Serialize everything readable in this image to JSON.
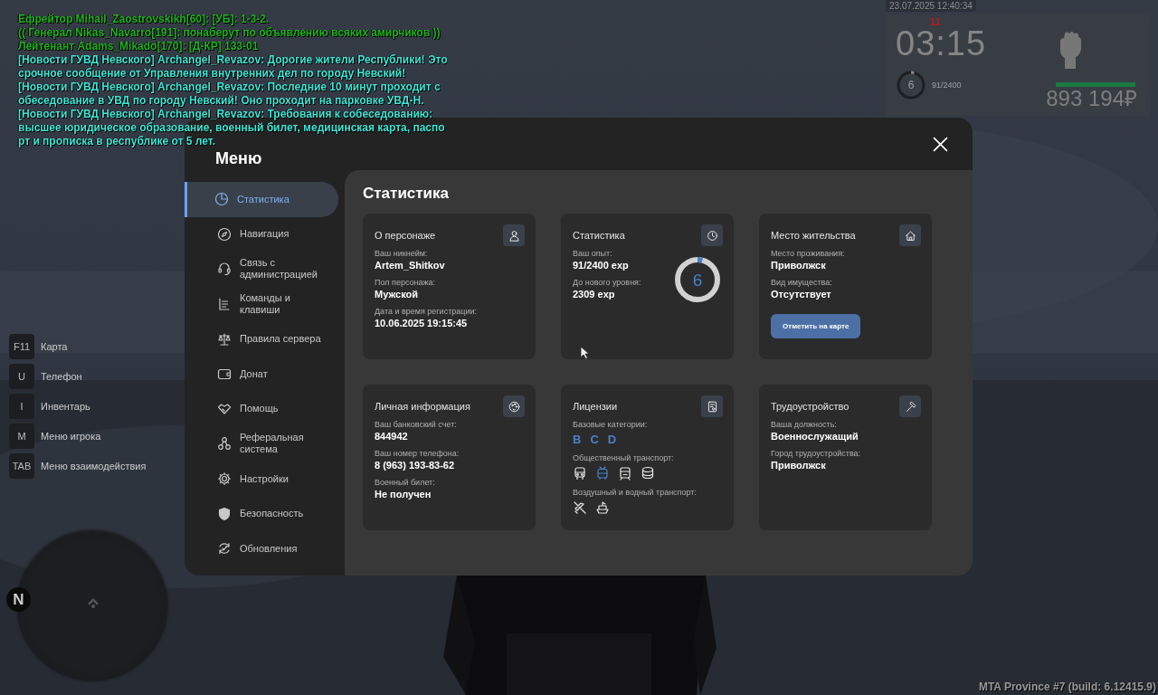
{
  "chat": [
    {
      "text": "Ефрейтор Mihail_Zaostrovskikh[60]: [УБ]: 1-3-2.",
      "color": "#1fb51f"
    },
    {
      "text": "(( Генерал Nikas_Navarro[191]: понаберут по объявлению всяких амирчиков ))",
      "color": "#1fb51f"
    },
    {
      "text": "Лейтенант Adams_Mikado[170]: [Д-КР] 133-01",
      "color": "#1fb51f"
    },
    {
      "text": "[Новости ГУВД Невского] Archangel_Revazov: Дорогие жители Республики! Это",
      "color": "#3ee8d8"
    },
    {
      "text": "срочное сообщение от Управления внутренних дел по городу Невский!",
      "color": "#3ee8d8"
    },
    {
      "text": "[Новости ГУВД Невского] Archangel_Revazov: Последние 10 минут проходит с",
      "color": "#3ee8d8"
    },
    {
      "text": "обеседование в УВД по городу Невский! Оно проходит на парковке УВД-Н.",
      "color": "#3ee8d8"
    },
    {
      "text": "[Новости ГУВД Невского] Archangel_Revazov: Требования к собеседованию:",
      "color": "#3ee8d8"
    },
    {
      "text": "высшее юридическое образование, военный билет, медицинская карта, паспо",
      "color": "#3ee8d8"
    },
    {
      "text": "рт и прописка в республике от 5 лет.",
      "color": "#3ee8d8"
    }
  ],
  "hud": {
    "date": "23.07.2025 12:40:34",
    "alert": "11",
    "time": "03:15",
    "ring": {
      "label": "6",
      "level": 0.04
    },
    "xp": "91/2400",
    "health": {
      "level": 1
    },
    "money": "893 194₽"
  },
  "keys": [
    {
      "key": "F11",
      "label": "Карта"
    },
    {
      "key": "U",
      "label": "Телефон"
    },
    {
      "key": "I",
      "label": "Инвентарь"
    },
    {
      "key": "M",
      "label": "Меню игрока"
    },
    {
      "key": "TAB",
      "label": "Меню взаимодействия"
    }
  ],
  "minimap": {
    "north": "N"
  },
  "menu": {
    "title": "Меню",
    "sidebar": [
      {
        "label": "Статистика",
        "selected": true
      },
      {
        "label": "Навигация",
        "selected": false
      },
      {
        "label": "Связь с администрацией",
        "selected": false
      },
      {
        "label": "Команды и клавиши",
        "selected": false
      },
      {
        "label": "Правила сервера",
        "selected": false
      },
      {
        "label": "Донат",
        "selected": false
      },
      {
        "label": "Помощь",
        "selected": false
      },
      {
        "label": "Реферальная система",
        "selected": false
      },
      {
        "label": "Настройки",
        "selected": false
      },
      {
        "label": "Безопасность",
        "selected": false
      },
      {
        "label": "Обновления",
        "selected": false
      }
    ],
    "page_title": "Статистика",
    "cards": [
      {
        "title": "О персонаже",
        "fields": [
          {
            "label": "Ваш никнейм:",
            "value": "Artem_Shitkov"
          },
          {
            "label": "Пол персонажа:",
            "value": "Мужской"
          },
          {
            "label": "Дата и время регистрации:",
            "value": "10.06.2025 19:15:45"
          }
        ]
      },
      {
        "title": "Статистика",
        "fields": [
          {
            "label": "Ваш опыт:",
            "value": "91/2400 exp"
          },
          {
            "label": "До нового уровня:",
            "value": "2309 exp"
          }
        ],
        "donut": {
          "label": "6",
          "level": 0.04
        }
      },
      {
        "title": "Место жительства",
        "fields": [
          {
            "label": "Место проживания:",
            "value": "Приволжск"
          },
          {
            "label": "Вид имущества:",
            "value": "Отсутствует"
          }
        ],
        "button": "Отметить на карте"
      },
      {
        "title": "Личная информация",
        "fields": [
          {
            "label": "Ваш банковский счет:",
            "value": "844942"
          },
          {
            "label": "Ваш номер телефона:",
            "value": "8 (963) 193-83-62"
          },
          {
            "label": "Военный билет:",
            "value": "Не получен"
          }
        ]
      },
      {
        "title": "Лицензии",
        "sections": [
          {
            "kind": "letters",
            "label": "Базовые категории:",
            "items": [
              {
                "text": "B",
                "active": true
              },
              {
                "text": "C",
                "active": true
              },
              {
                "text": "D",
                "active": true
              }
            ]
          },
          {
            "kind": "icons",
            "label": "Общественный транспорт:",
            "items": [
              {
                "active": false
              },
              {
                "active": true
              },
              {
                "active": false
              },
              {
                "active": false
              }
            ]
          },
          {
            "kind": "icons",
            "label": "Воздушный и водный транспорт:",
            "items": [
              {
                "active": false
              },
              {
                "active": false
              }
            ]
          }
        ]
      },
      {
        "title": "Трудоустройство",
        "fields": [
          {
            "label": "Ваша должность:",
            "value": "Военнослужащий"
          },
          {
            "label": "Город трудоустройства:",
            "value": "Приволжск"
          }
        ]
      }
    ]
  },
  "build": "MTA Province #7 (build: 6.12415.9)"
}
